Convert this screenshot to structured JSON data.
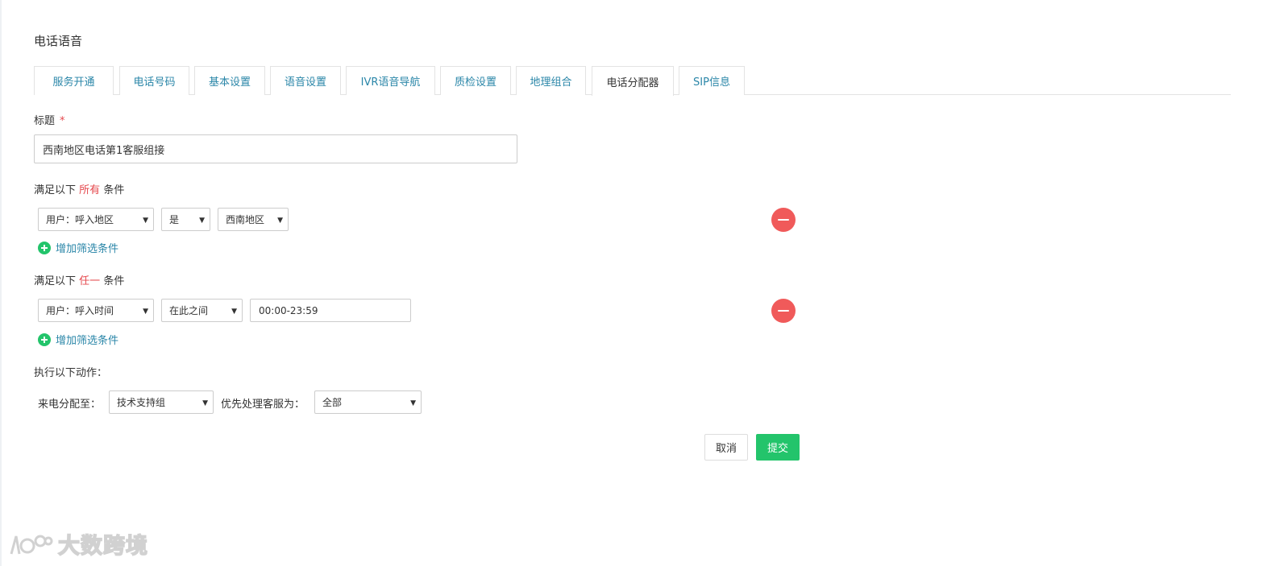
{
  "page": {
    "title": "电话语音"
  },
  "tabs": [
    {
      "label": "服务开通",
      "active": false
    },
    {
      "label": "电话号码",
      "active": false
    },
    {
      "label": "基本设置",
      "active": false
    },
    {
      "label": "语音设置",
      "active": false
    },
    {
      "label": "IVR语音导航",
      "active": false
    },
    {
      "label": "质检设置",
      "active": false
    },
    {
      "label": "地理组合",
      "active": false
    },
    {
      "label": "电话分配器",
      "active": true
    },
    {
      "label": "SIP信息",
      "active": false
    }
  ],
  "form": {
    "title_label": "标题",
    "required_mark": "*",
    "title_value": "西南地区电话第1客服组接",
    "all_conditions": {
      "prefix": "满足以下",
      "keyword": "所有",
      "suffix": "条件",
      "row": {
        "field": "用户：呼入地区",
        "operator": "是",
        "value": "西南地区"
      },
      "add_label": "增加筛选条件"
    },
    "any_conditions": {
      "prefix": "满足以下",
      "keyword": "任一",
      "suffix": "条件",
      "row": {
        "field": "用户：呼入时间",
        "operator": "在此之间",
        "value": "00:00-23:59"
      },
      "add_label": "增加筛选条件"
    },
    "actions": {
      "heading": "执行以下动作：",
      "assign_label": "来电分配至：",
      "assign_value": "技术支持组",
      "priority_label": "优先处理客服为：",
      "priority_value": "全部"
    },
    "buttons": {
      "cancel": "取消",
      "submit": "提交"
    }
  },
  "watermark": {
    "text": "大数跨境"
  },
  "colors": {
    "accent_link": "#2a86a8",
    "highlight_red": "#e5484d",
    "remove_red": "#f05a5a",
    "submit_green": "#23c46b"
  },
  "icons": {
    "remove": "minus-circle-icon",
    "add": "plus-circle-icon",
    "dropdown": "caret-down-icon"
  }
}
